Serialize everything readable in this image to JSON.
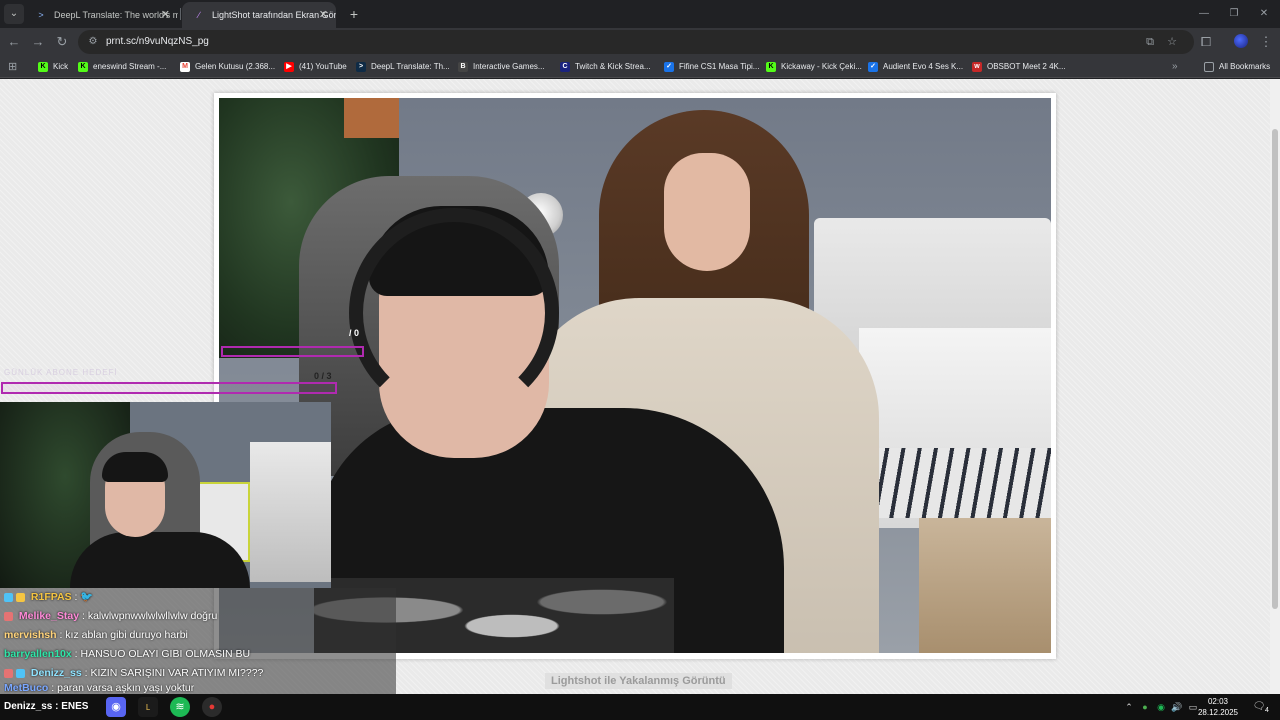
{
  "tabs": [
    {
      "title": "DeepL Translate: The world's most accurate translator",
      "icon": "deepl-icon",
      "active": false
    },
    {
      "title": "LightShot tarafından Ekran Görüntüsü",
      "icon": "lightshot-feather-icon",
      "active": true
    }
  ],
  "toolbar": {
    "url": "prnt.sc/n9vuNqzNS_pg"
  },
  "bookmarks": [
    {
      "label": "Kick",
      "icon": "kick-icon",
      "color": "#53fc18"
    },
    {
      "label": "eneswind Stream -...",
      "icon": "kick-icon",
      "color": "#53fc18"
    },
    {
      "label": "Gelen Kutusu (2.368...",
      "icon": "gmail-icon",
      "color": "#ea4335"
    },
    {
      "label": "(41) YouTube",
      "icon": "youtube-icon",
      "color": "#ff0000"
    },
    {
      "label": "DeepL Translate: Th...",
      "icon": "deepl-icon",
      "color": "#0f2b46"
    },
    {
      "label": "Interactive Games...",
      "icon": "page-icon",
      "color": "#5f6368"
    },
    {
      "label": "Twitch & Kick Strea...",
      "icon": "cp-icon",
      "color": "#1a73e8"
    },
    {
      "label": "Fifine CS1 Masa Tipi...",
      "icon": "check-icon",
      "color": "#1a73e8"
    },
    {
      "label": "Kickaway - Kick Çeki...",
      "icon": "kickaway-icon",
      "color": "#53fc18"
    },
    {
      "label": "Audient Evo 4 Ses K...",
      "icon": "check-icon",
      "color": "#1a73e8"
    },
    {
      "label": "OBSBOT Meet 2 4K...",
      "icon": "obsbot-icon",
      "color": "#c62828"
    }
  ],
  "all_bookmarks": "All Bookmarks",
  "page": {
    "caption": "Lightshot ile Yakalanmış Görüntü",
    "overlay_counter": "/ 0",
    "goal_label": "GÜNLÜK ABONE HEDEFİ",
    "goal_count": "0 / 3"
  },
  "chat": [
    {
      "user": "R1FPAS",
      "sep": " : ",
      "message": "",
      "color": "#f5c542"
    },
    {
      "user": "Melike_Stay",
      "sep": " : ",
      "message": "kalwlwpnwwlwlwllwlw doğru",
      "color": "#ff8ad8"
    },
    {
      "user": "mervishsh",
      "sep": " : ",
      "message": "kız ablan gibi duruyo harbi",
      "color": "#ffd37a"
    },
    {
      "user": "barryallen10x",
      "sep": " : ",
      "message": "HANSUO OLAYI GIBI OLMASIN BU",
      "color": "#2ee6a8"
    },
    {
      "user": "Denizz_ss",
      "sep": " : ",
      "message": "KIZIN SARIŞINI VAR ATIYIM MI????",
      "color": "#8fe3ff"
    },
    {
      "user": "MetBuco",
      "sep": " : ",
      "message": "paran varsa aşkın yaşı yoktur",
      "color": "#7aa7ff"
    }
  ],
  "taskbar": {
    "user_label": "Denizz_ss : ENES",
    "time": "02:03",
    "date": "28.12.2025",
    "notifications": "4"
  }
}
